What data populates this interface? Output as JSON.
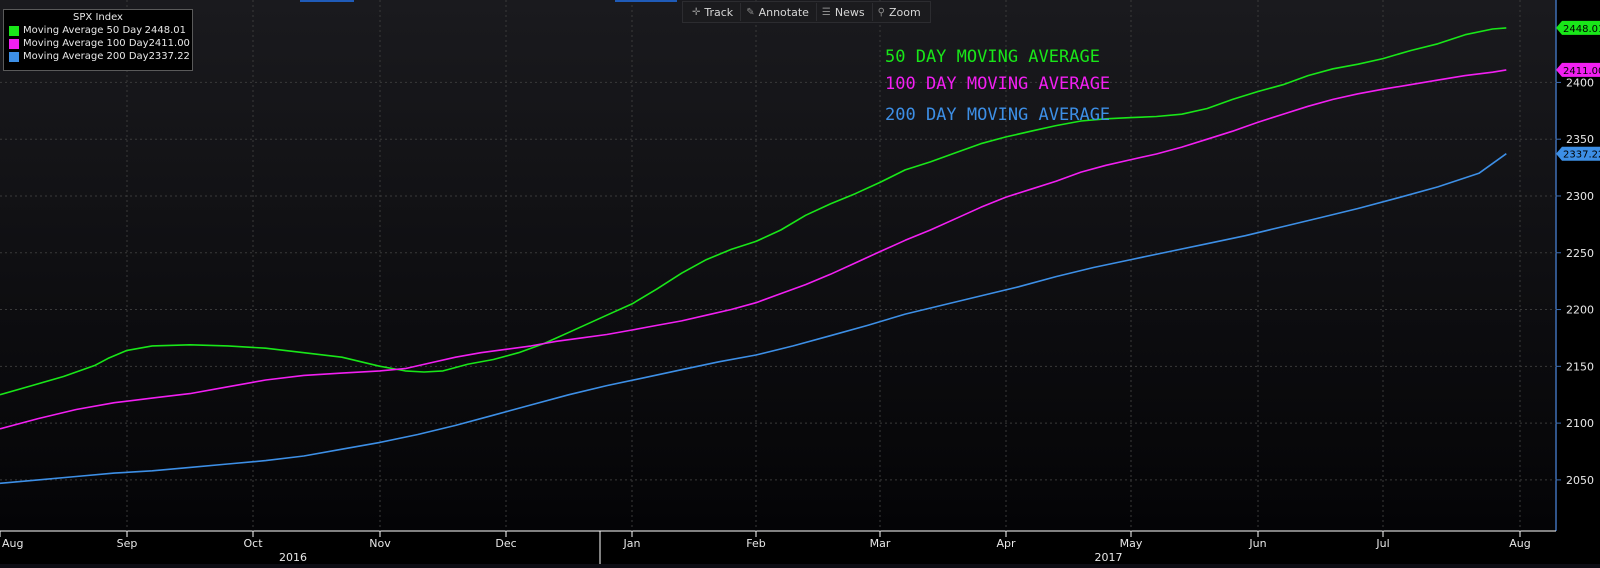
{
  "toolbar": {
    "items": [
      {
        "label": "Track",
        "icon": "crosshair-icon"
      },
      {
        "label": "Annotate",
        "icon": "pencil-icon"
      },
      {
        "label": "News",
        "icon": "news-icon"
      },
      {
        "label": "Zoom",
        "icon": "magnifier-icon"
      }
    ]
  },
  "legend": {
    "title": "SPX Index",
    "items": [
      {
        "name": "Moving Average 50 Day",
        "value": "2448.01",
        "color": "#19e619"
      },
      {
        "name": "Moving Average 100 Day",
        "value": "2411.00",
        "color": "#f21ff2"
      },
      {
        "name": "Moving Average 200 Day",
        "value": "2337.22",
        "color": "#3d8fe6"
      }
    ]
  },
  "annotations": [
    {
      "text": "50 DAY MOVING AVERAGE",
      "color": "#19e619"
    },
    {
      "text": "100 DAY MOVING AVERAGE",
      "color": "#f21ff2"
    },
    {
      "text": "200 DAY MOVING AVERAGE",
      "color": "#3d8fe6"
    }
  ],
  "chart_data": {
    "type": "line",
    "x_months": [
      "Aug",
      "Sep",
      "Oct",
      "Nov",
      "Dec",
      "Jan",
      "Feb",
      "Mar",
      "Apr",
      "May",
      "Jun",
      "Jul",
      "Aug"
    ],
    "x_years": [
      {
        "label": "2016",
        "month_index": 2
      },
      {
        "label": "2017",
        "month_index": 8.5
      }
    ],
    "y_ticks": [
      2050,
      2100,
      2150,
      2200,
      2250,
      2300,
      2350,
      2400
    ],
    "ylim": [
      2005,
      2462
    ],
    "y_axis_side": "right",
    "grid": true,
    "legend_position": "top-left",
    "series": [
      {
        "name": "Moving Average 50 Day",
        "color": "#19e619",
        "last_value": "2448.01",
        "points": [
          [
            0,
            2125
          ],
          [
            0.25,
            2133
          ],
          [
            0.5,
            2141
          ],
          [
            0.75,
            2151
          ],
          [
            0.85,
            2157
          ],
          [
            1.0,
            2164
          ],
          [
            1.2,
            2168
          ],
          [
            1.5,
            2169
          ],
          [
            1.8,
            2168
          ],
          [
            2.1,
            2166
          ],
          [
            2.4,
            2162
          ],
          [
            2.7,
            2158
          ],
          [
            3.0,
            2150
          ],
          [
            3.2,
            2146
          ],
          [
            3.35,
            2145
          ],
          [
            3.5,
            2146
          ],
          [
            3.7,
            2152
          ],
          [
            3.9,
            2156
          ],
          [
            4.1,
            2162
          ],
          [
            4.3,
            2170
          ],
          [
            4.5,
            2180
          ],
          [
            4.8,
            2195
          ],
          [
            5.0,
            2205
          ],
          [
            5.2,
            2218
          ],
          [
            5.4,
            2232
          ],
          [
            5.6,
            2244
          ],
          [
            5.8,
            2253
          ],
          [
            6.0,
            2260
          ],
          [
            6.2,
            2270
          ],
          [
            6.4,
            2283
          ],
          [
            6.6,
            2293
          ],
          [
            6.8,
            2302
          ],
          [
            7.0,
            2312
          ],
          [
            7.2,
            2323
          ],
          [
            7.4,
            2330
          ],
          [
            7.6,
            2338
          ],
          [
            7.8,
            2346
          ],
          [
            8.0,
            2352
          ],
          [
            8.2,
            2357
          ],
          [
            8.4,
            2362
          ],
          [
            8.6,
            2366
          ],
          [
            8.8,
            2368
          ],
          [
            9.0,
            2369
          ],
          [
            9.2,
            2370
          ],
          [
            9.4,
            2372
          ],
          [
            9.6,
            2377
          ],
          [
            9.8,
            2385
          ],
          [
            10.0,
            2392
          ],
          [
            10.2,
            2398
          ],
          [
            10.4,
            2406
          ],
          [
            10.6,
            2412
          ],
          [
            10.8,
            2416
          ],
          [
            11.0,
            2421
          ],
          [
            11.2,
            2428
          ],
          [
            11.4,
            2434
          ],
          [
            11.6,
            2442
          ],
          [
            11.8,
            2447
          ],
          [
            11.9,
            2448.01
          ]
        ]
      },
      {
        "name": "Moving Average 100 Day",
        "color": "#f21ff2",
        "last_value": "2411.00",
        "points": [
          [
            0,
            2095
          ],
          [
            0.3,
            2104
          ],
          [
            0.6,
            2112
          ],
          [
            0.9,
            2118
          ],
          [
            1.2,
            2122
          ],
          [
            1.5,
            2126
          ],
          [
            1.8,
            2132
          ],
          [
            2.1,
            2138
          ],
          [
            2.4,
            2142
          ],
          [
            2.7,
            2144
          ],
          [
            3.0,
            2146
          ],
          [
            3.2,
            2148
          ],
          [
            3.4,
            2153
          ],
          [
            3.6,
            2158
          ],
          [
            3.8,
            2162
          ],
          [
            4.0,
            2165
          ],
          [
            4.2,
            2168
          ],
          [
            4.4,
            2172
          ],
          [
            4.6,
            2175
          ],
          [
            4.8,
            2178
          ],
          [
            5.0,
            2182
          ],
          [
            5.2,
            2186
          ],
          [
            5.4,
            2190
          ],
          [
            5.6,
            2195
          ],
          [
            5.8,
            2200
          ],
          [
            6.0,
            2206
          ],
          [
            6.2,
            2214
          ],
          [
            6.4,
            2222
          ],
          [
            6.6,
            2231
          ],
          [
            6.8,
            2241
          ],
          [
            7.0,
            2251
          ],
          [
            7.2,
            2261
          ],
          [
            7.4,
            2270
          ],
          [
            7.6,
            2280
          ],
          [
            7.8,
            2290
          ],
          [
            8.0,
            2299
          ],
          [
            8.2,
            2306
          ],
          [
            8.4,
            2313
          ],
          [
            8.6,
            2321
          ],
          [
            8.8,
            2327
          ],
          [
            9.0,
            2332
          ],
          [
            9.2,
            2337
          ],
          [
            9.4,
            2343
          ],
          [
            9.6,
            2350
          ],
          [
            9.8,
            2357
          ],
          [
            10.0,
            2365
          ],
          [
            10.2,
            2372
          ],
          [
            10.4,
            2379
          ],
          [
            10.6,
            2385
          ],
          [
            10.8,
            2390
          ],
          [
            11.0,
            2394
          ],
          [
            11.2,
            2398
          ],
          [
            11.4,
            2402
          ],
          [
            11.6,
            2406
          ],
          [
            11.8,
            2409
          ],
          [
            11.9,
            2411.0
          ]
        ]
      },
      {
        "name": "Moving Average 200 Day",
        "color": "#3d8fe6",
        "last_value": "2337.22",
        "points": [
          [
            0,
            2047
          ],
          [
            0.3,
            2050
          ],
          [
            0.6,
            2053
          ],
          [
            0.9,
            2056
          ],
          [
            1.2,
            2058
          ],
          [
            1.5,
            2061
          ],
          [
            1.8,
            2064
          ],
          [
            2.1,
            2067
          ],
          [
            2.4,
            2071
          ],
          [
            2.7,
            2077
          ],
          [
            3.0,
            2083
          ],
          [
            3.3,
            2090
          ],
          [
            3.6,
            2098
          ],
          [
            3.9,
            2107
          ],
          [
            4.2,
            2116
          ],
          [
            4.5,
            2125
          ],
          [
            4.8,
            2133
          ],
          [
            5.1,
            2140
          ],
          [
            5.4,
            2147
          ],
          [
            5.7,
            2154
          ],
          [
            6.0,
            2160
          ],
          [
            6.3,
            2168
          ],
          [
            6.6,
            2177
          ],
          [
            6.9,
            2186
          ],
          [
            7.2,
            2196
          ],
          [
            7.5,
            2204
          ],
          [
            7.8,
            2212
          ],
          [
            8.1,
            2220
          ],
          [
            8.4,
            2229
          ],
          [
            8.7,
            2237
          ],
          [
            9.0,
            2244
          ],
          [
            9.3,
            2251
          ],
          [
            9.6,
            2258
          ],
          [
            9.9,
            2265
          ],
          [
            10.2,
            2273
          ],
          [
            10.5,
            2281
          ],
          [
            10.8,
            2289
          ],
          [
            11.1,
            2298
          ],
          [
            11.4,
            2308
          ],
          [
            11.7,
            2320
          ],
          [
            11.9,
            2337.22
          ]
        ]
      }
    ]
  }
}
